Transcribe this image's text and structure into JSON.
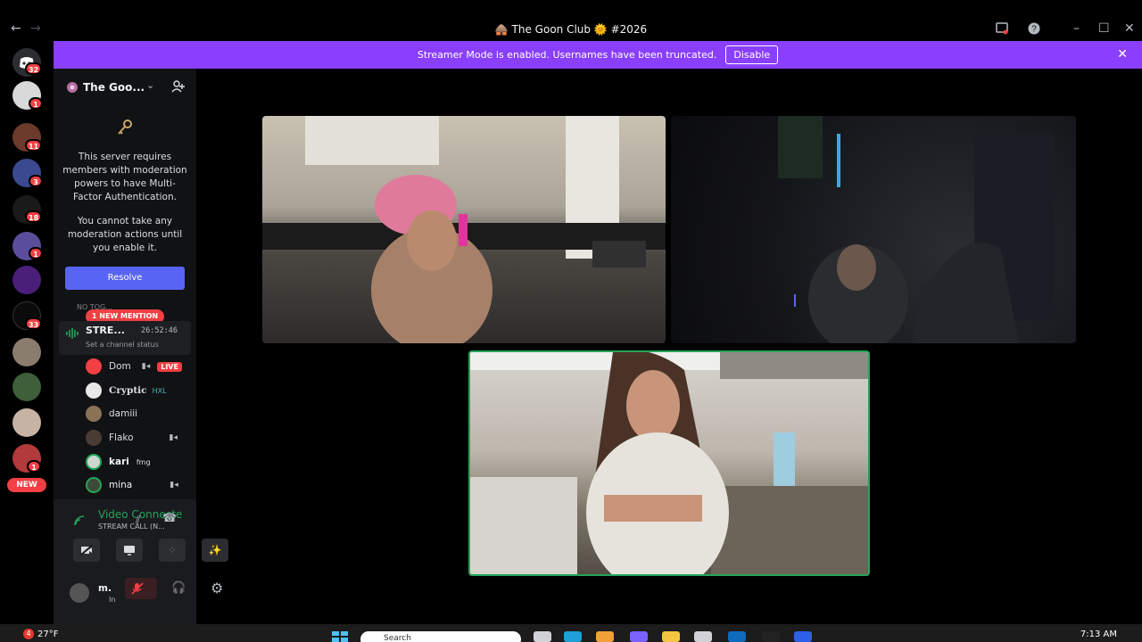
{
  "window": {
    "title": "🛖 The Goon Club 🌞 #2026",
    "back_icon": "←",
    "forward_icon": "→"
  },
  "banner": {
    "message": "Streamer Mode is enabled. Usernames have been truncated.",
    "disable_label": "Disable",
    "color": "#8a3ffc"
  },
  "rail": {
    "badges": [
      "32",
      "1",
      "11",
      "3",
      "18",
      "1",
      "33",
      "1",
      "1"
    ],
    "new_label": "NEW"
  },
  "server": {
    "name": "The Goo...",
    "mfa_text": "This server requires members with moderation powers to have Multi-Factor Authentication.",
    "mfa_text2": "You cannot take any moderation actions until you enable it.",
    "resolve_label": "Resolve"
  },
  "channels": {
    "category": "NO TOG...",
    "mention_pill": "1 NEW MENTION",
    "stream_channel": "STRE...",
    "stream_time": "26:52:46",
    "stream_status": "Set a channel status",
    "members": [
      {
        "name": "Dom",
        "live": "LIVE"
      },
      {
        "name": "Cryptic",
        "tag": "HXL"
      },
      {
        "name": "damiii"
      },
      {
        "name": "Flako"
      },
      {
        "name": "kari",
        "tag": "fmg"
      },
      {
        "name": "mina"
      }
    ]
  },
  "voice": {
    "title": "Video Connecte",
    "subtitle": "STREAM CALL (N...",
    "user": "m.",
    "user_status": "In"
  },
  "taskbar": {
    "weather_badge": "4",
    "temperature": "27°F",
    "search_placeholder": "Search",
    "time": "7:13 AM"
  }
}
